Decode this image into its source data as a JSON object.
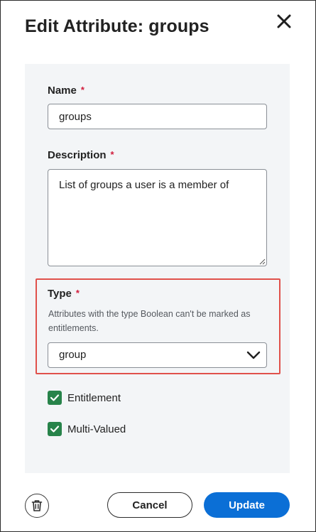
{
  "dialog": {
    "title": "Edit Attribute: groups",
    "close_icon": "close-icon"
  },
  "form": {
    "name": {
      "label": "Name",
      "required_mark": "*",
      "value": "groups"
    },
    "description": {
      "label": "Description",
      "required_mark": "*",
      "value": "List of groups a user is a member of"
    },
    "type": {
      "label": "Type",
      "required_mark": "*",
      "help": "Attributes with the type Boolean can't be marked as entitlements.",
      "selected": "group",
      "highlight_color": "#e0514b"
    },
    "checkboxes": [
      {
        "label": "Entitlement",
        "checked": true
      },
      {
        "label": "Multi-Valued",
        "checked": true
      }
    ],
    "checkbox_color": "#27834a"
  },
  "footer": {
    "delete_icon": "trash-icon",
    "cancel_label": "Cancel",
    "update_label": "Update",
    "primary_color": "#0b6fd6"
  }
}
